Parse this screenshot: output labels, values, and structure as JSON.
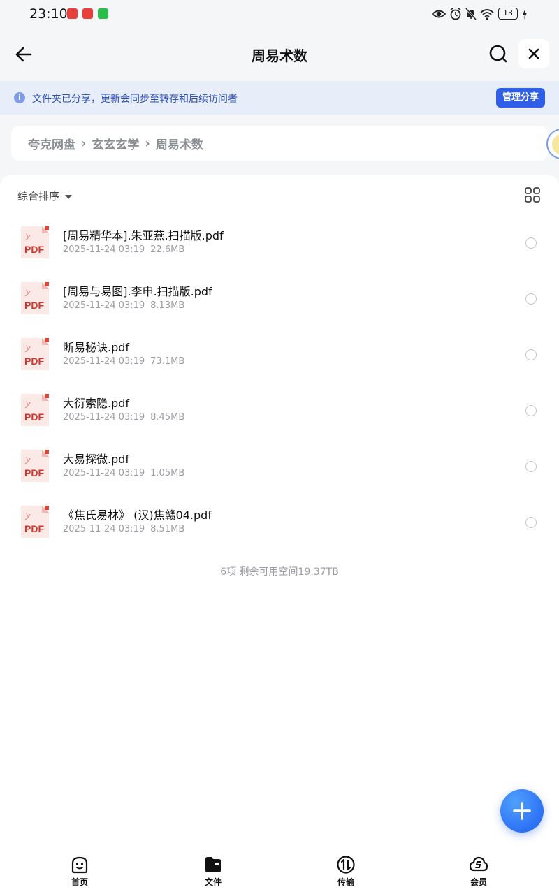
{
  "status_bar": {
    "time": "23:10",
    "battery": "13"
  },
  "header": {
    "title": "周易术数"
  },
  "share_banner": {
    "info_icon": "i",
    "text": "文件夹已分享，更新会同步至转存和后续访问者",
    "button_label": "管理分享"
  },
  "breadcrumb": {
    "items": [
      "夸克网盘",
      "玄玄玄学",
      "周易术数"
    ],
    "separator": "›"
  },
  "toolbar": {
    "sort_label": "综合排序"
  },
  "files": [
    {
      "name": "[周易精华本].朱亚燕.扫描版.pdf",
      "date": "2025-11-24 03:19",
      "size": "22.6MB",
      "icon": "pdf-icon",
      "icon_label": "PDF"
    },
    {
      "name": "[周易与易图].李申.扫描版.pdf",
      "date": "2025-11-24 03:19",
      "size": "8.13MB",
      "icon": "pdf-icon",
      "icon_label": "PDF"
    },
    {
      "name": "断易秘诀.pdf",
      "date": "2025-11-24 03:19",
      "size": "73.1MB",
      "icon": "pdf-icon",
      "icon_label": "PDF"
    },
    {
      "name": "大衍索隐.pdf",
      "date": "2025-11-24 03:19",
      "size": "8.45MB",
      "icon": "pdf-icon",
      "icon_label": "PDF"
    },
    {
      "name": "大易探微.pdf",
      "date": "2025-11-24 03:19",
      "size": "1.05MB",
      "icon": "pdf-icon",
      "icon_label": "PDF"
    },
    {
      "name": "《焦氏易林》 (汉)焦赣04.pdf",
      "date": "2025-11-24 03:19",
      "size": "8.51MB",
      "icon": "pdf-icon",
      "icon_label": "PDF"
    }
  ],
  "summary": "6项 剩余可用空间19.37TB",
  "bottom_nav": {
    "items": [
      {
        "label": "首页",
        "icon": "home-smile-icon"
      },
      {
        "label": "文件",
        "icon": "folder-icon"
      },
      {
        "label": "传输",
        "icon": "transfer-icon"
      },
      {
        "label": "会员",
        "icon": "vip-cloud-icon"
      }
    ]
  },
  "colors": {
    "accent": "#2f5fe8",
    "banner_bg": "#e8edfa",
    "pdf_red": "#d9463a"
  }
}
